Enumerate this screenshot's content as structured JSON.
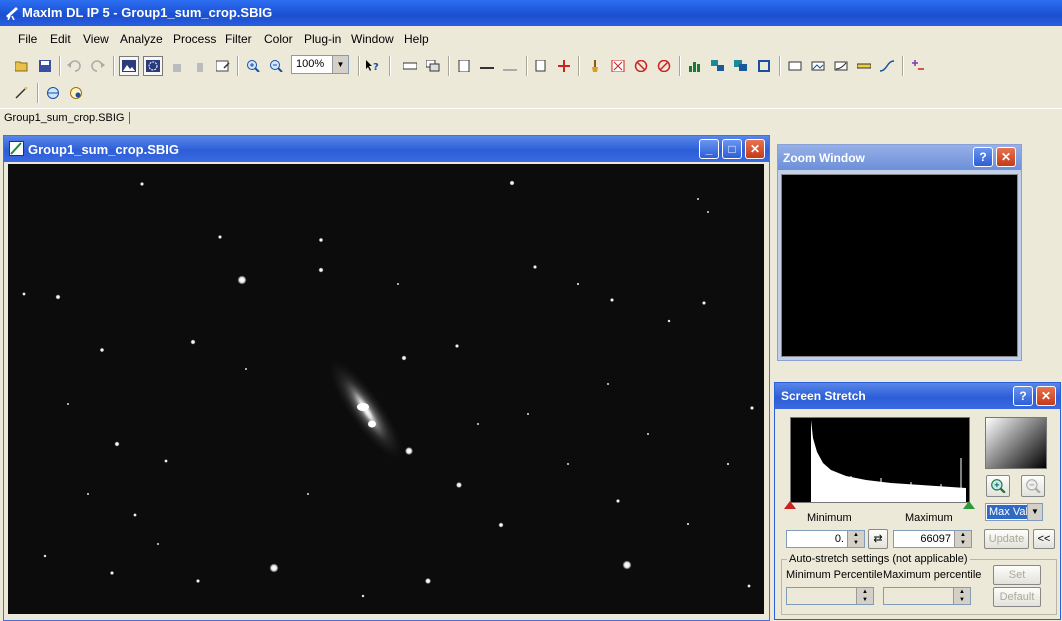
{
  "app": {
    "title": "MaxIm DL IP 5 - Group1_sum_crop.SBIG"
  },
  "menu": [
    "File",
    "Edit",
    "View",
    "Analyze",
    "Process",
    "Filter",
    "Color",
    "Plug-in",
    "Window",
    "Help"
  ],
  "toolbar": {
    "zoom_value": "100%"
  },
  "tabs": [
    {
      "label": "Group1_sum_crop.SBIG"
    }
  ],
  "image_window": {
    "title": "Group1_sum_crop.SBIG"
  },
  "zoom_window": {
    "title": "Zoom Window"
  },
  "screen_stretch": {
    "title": "Screen Stretch",
    "minimum_label": "Minimum",
    "maximum_label": "Maximum",
    "minimum_value": "0.",
    "maximum_value": "66097",
    "mode_value": "Max Val",
    "update_label": "Update",
    "collapse_label": "<<",
    "auto_stretch_label": "Auto-stretch settings (not applicable)",
    "min_percentile_label": "Minimum Percentile",
    "max_percentile_label": "Maximum percentile",
    "set_label": "Set",
    "default_label": "Default"
  },
  "colors": {
    "title_bar": "#2c5ed8",
    "accent_red": "#cc2222"
  }
}
